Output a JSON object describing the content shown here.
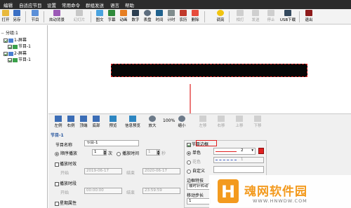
{
  "menu": [
    "编辑",
    "自适应节目",
    "设置",
    "常用命令",
    "群组发送",
    "语言",
    "帮助"
  ],
  "toolbar": {
    "items": [
      "打开",
      "另存",
      "节目",
      "炫动背景",
      "幻灯片",
      "图文",
      "字幕",
      "动画",
      "数字",
      "表盘",
      "时间",
      "计时",
      "农历",
      "删除",
      "调亮",
      "相打",
      "发送",
      "停止",
      "USB下载",
      "退出"
    ]
  },
  "tree": {
    "root": "分组:1",
    "screen1": "1-屏幕",
    "program1": "节目-1",
    "screen2": "2-屏幕",
    "program2": "节目-1"
  },
  "prop_toolbar": {
    "left_label": "左例",
    "right_label": "右例",
    "top_label": "顶端",
    "bottom_label": "底部",
    "preview_label": "预览",
    "info_preview_label": "信息预览",
    "zoom_in_label": "放大",
    "zoom_value": "100%",
    "zoom_out_label": "缩小",
    "dim_labels": [
      "左移",
      "右移",
      "上移",
      "下移"
    ]
  },
  "program": {
    "header": "节目-1",
    "name_label": "节目名称",
    "name_value": "节目-1",
    "order_play_label": "顺序播放",
    "order_count": "1",
    "order_unit": "次",
    "fixed_time_label": "播放时间",
    "fixed_time_value": "1",
    "fixed_time_unit": "秒",
    "play_date_label": "播放时效",
    "start_label": "开始",
    "start_date": "2019-06-17",
    "end_label": "结束",
    "end_date": "2020-06-17",
    "play_period_label": "播放时段",
    "start_time": "00:00:00",
    "end_time": "23:59:59",
    "week_label": "星期属性"
  },
  "border": {
    "checkbox_label": "节目边框",
    "single_color_label": "单色",
    "single_value": "2",
    "flower_label": "花色",
    "flower_value": "1",
    "custom_label": "自定义",
    "effect_label": "边框特技",
    "effect_value": "顺时针转动",
    "speed_label": "移动步长",
    "speed_value": "1"
  },
  "watermark": {
    "title": "魂网软件园",
    "url": "WWW.HNWDW.COM"
  },
  "colors": {
    "accent": "#e02020",
    "watermark_orange": "#f39a1e"
  }
}
